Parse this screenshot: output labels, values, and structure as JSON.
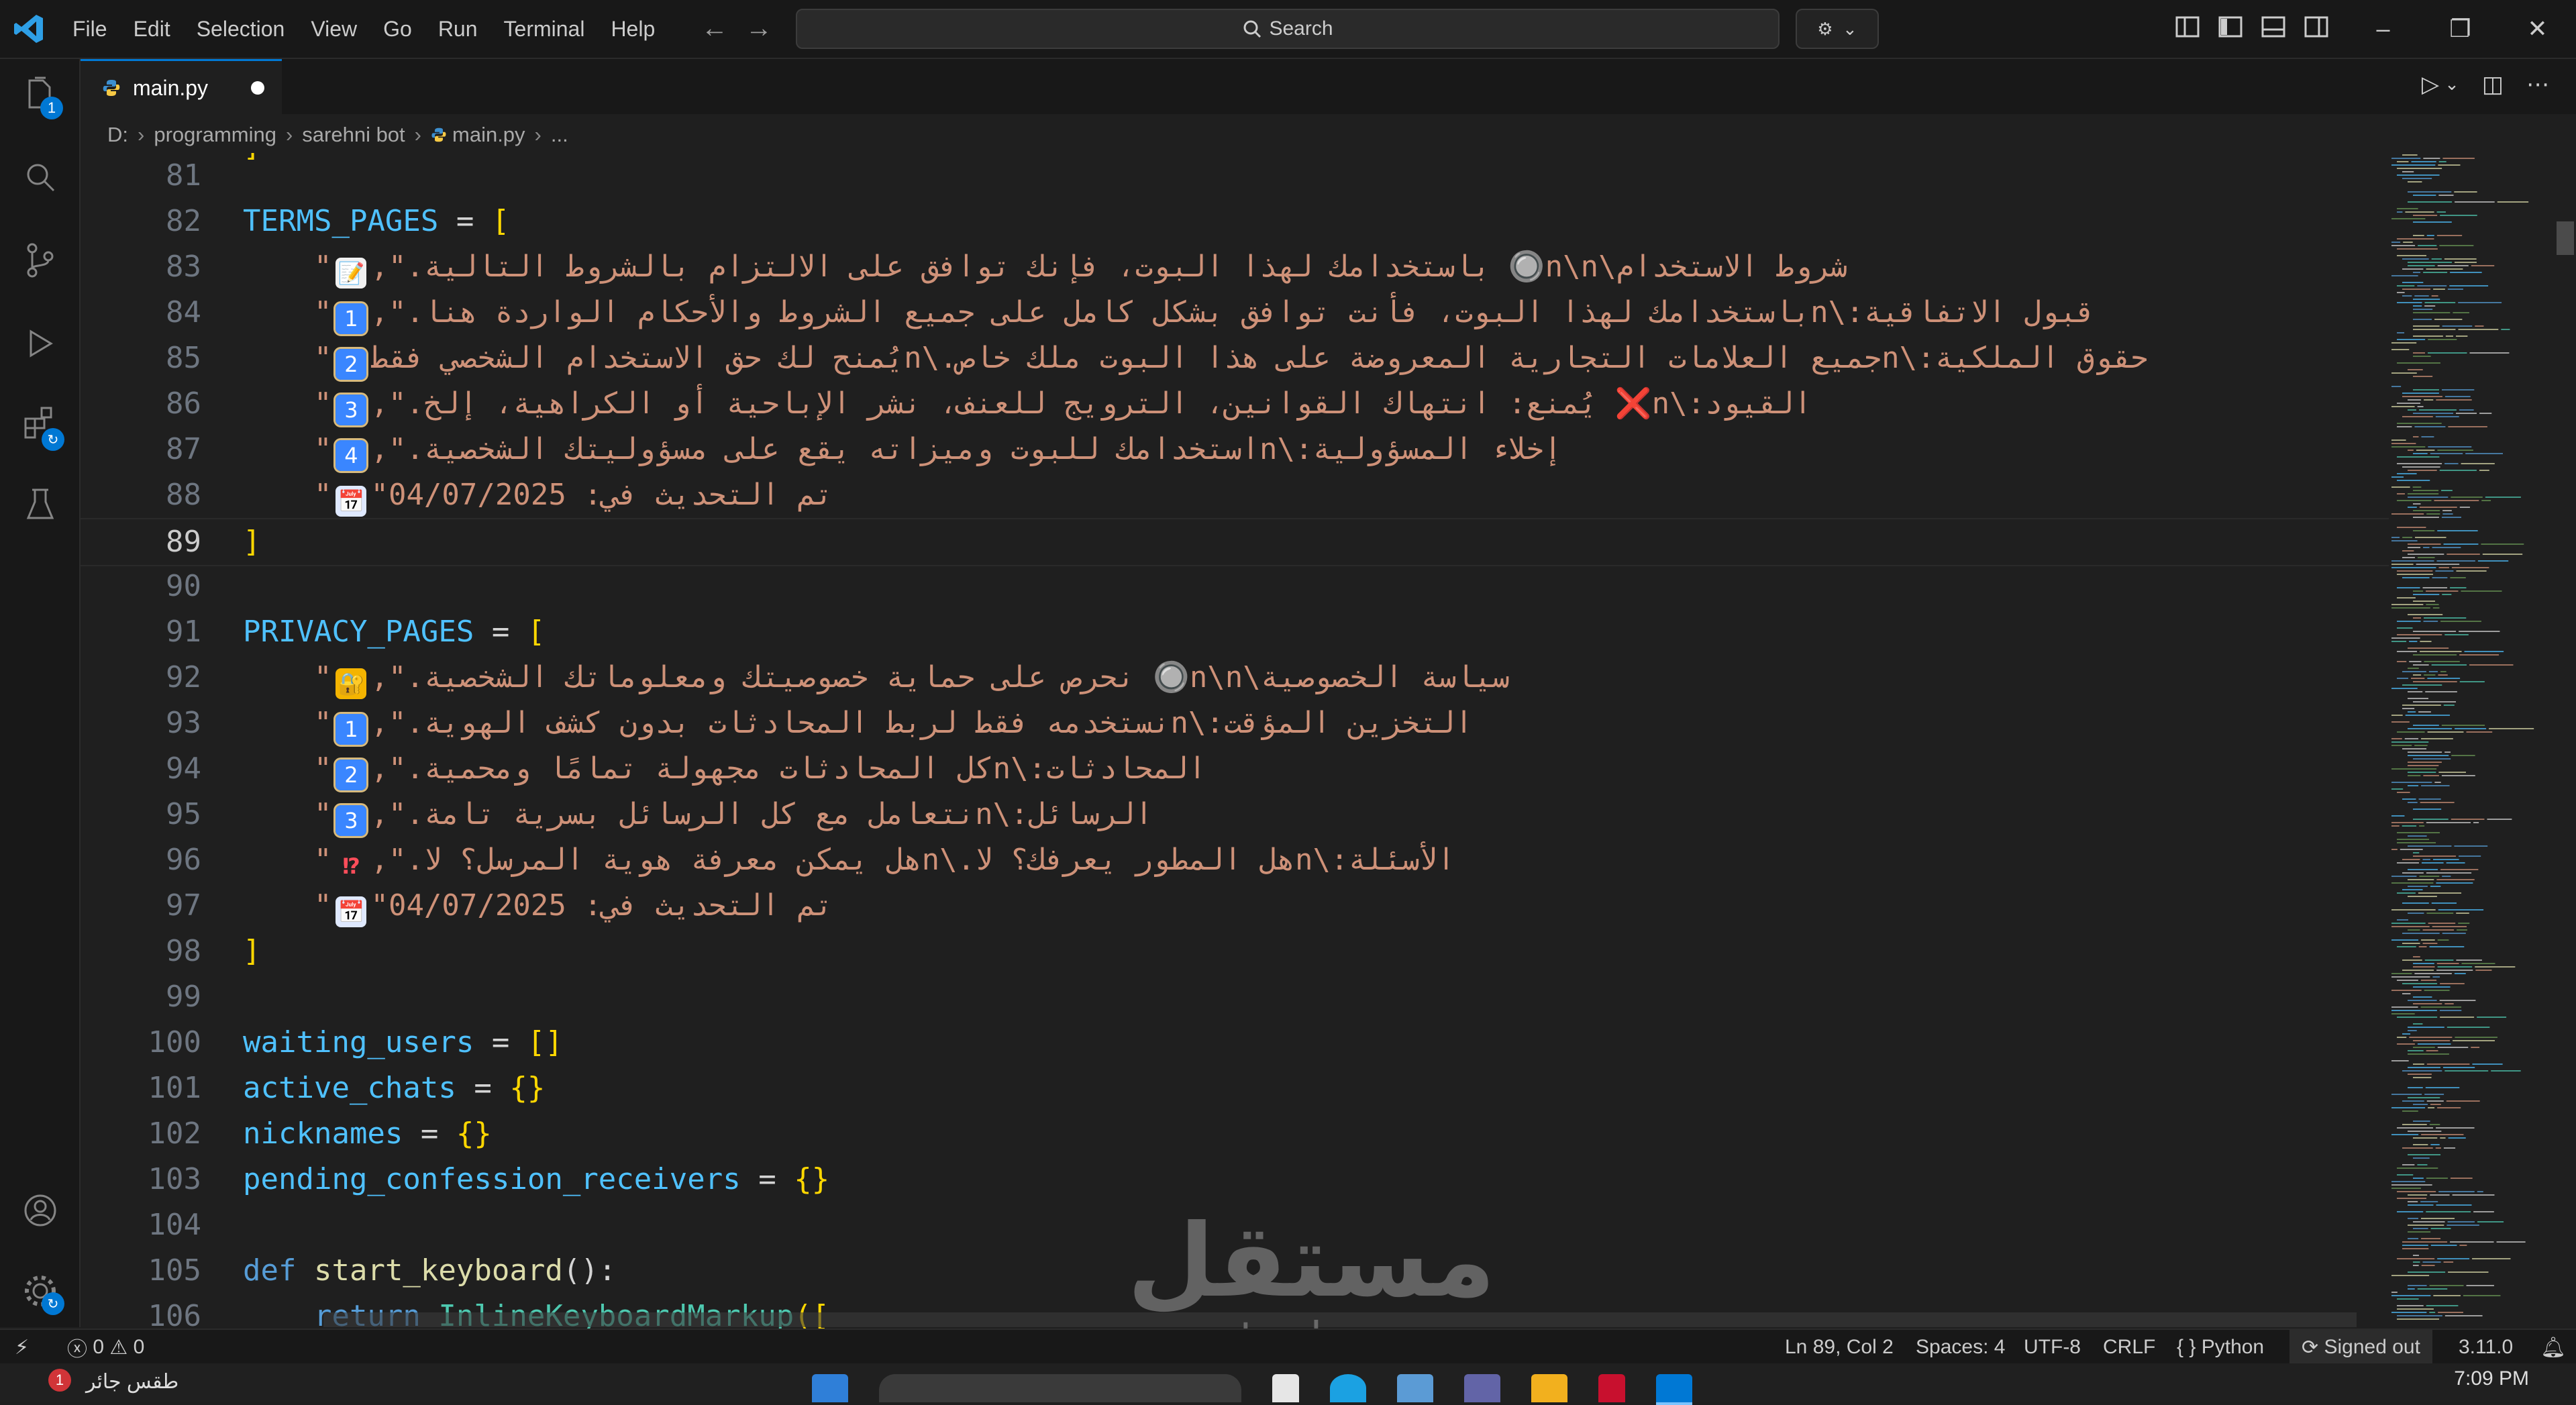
{
  "menu": [
    "File",
    "Edit",
    "Selection",
    "View",
    "Go",
    "Run",
    "Terminal",
    "Help"
  ],
  "search": {
    "placeholder": "Search"
  },
  "explorer_badge": "1",
  "tab": {
    "name": "main.py"
  },
  "breadcrumb": {
    "drive": "D:",
    "folder1": "programming",
    "folder2": "sarehni bot",
    "file": "main.py",
    "more": "..."
  },
  "editor": {
    "top_partial": "]",
    "lines": [
      {
        "n": "81"
      },
      {
        "n": "82",
        "var": "TERMS_PAGES",
        "op": " = ",
        "brk": "["
      },
      {
        "n": "83",
        "pre": "    \"",
        "emoji": "📝",
        "text": "شروط الاستخدام\\n\\n🔘 باستخدامك لهذا البوت، فإنك توافق على الالتزام بالشروط التالية.\","
      },
      {
        "n": "84",
        "pre": "    \"",
        "emoji": "1",
        "text": "قبول الاتفاقية:\\nباستخدامك لهذا البوت، فأنت توافق بشكل كامل على جميع الشروط والأحكام الواردة هنا.\","
      },
      {
        "n": "85",
        "pre": "    \"",
        "emoji": "2",
        "text": "حقوق الملكية:\\nجميع العلامات التجارية المعروضة على هذا البوت ملك خاص.\\nيُمنح لك حق الاستخدام الشخصي فقط"
      },
      {
        "n": "86",
        "pre": "    \"",
        "emoji": "3",
        "text": "القيود:\\n❌ يُمنع: انتهاك القوانين، الترويج للعنف، نشر الإباحية أو الكراهية، إلخ.\","
      },
      {
        "n": "87",
        "pre": "    \"",
        "emoji": "4",
        "text": "إخلاء المسؤولية:\\nاستخدامك للبوت وميزاته يقع على مسؤوليتك الشخصية.\","
      },
      {
        "n": "88",
        "pre": "    \"",
        "emoji": "📅",
        "text": "تم التحديث في: 04/07/2025\""
      },
      {
        "n": "89",
        "brk": "]",
        "current": true
      },
      {
        "n": "90"
      },
      {
        "n": "91",
        "var": "PRIVACY_PAGES",
        "op": " = ",
        "brk": "["
      },
      {
        "n": "92",
        "pre": "    \"",
        "emoji": "🔐",
        "text": "سياسة الخصوصية\\n\\n🔘 نحرص على حماية خصوصيتك ومعلوماتك الشخصية.\","
      },
      {
        "n": "93",
        "pre": "    \"",
        "emoji": "1",
        "text": "التخزين المؤقت:\\nنستخدمه فقط لربط المحادثات بدون كشف الهوية.\","
      },
      {
        "n": "94",
        "pre": "    \"",
        "emoji": "2",
        "text": "المحادثات:\\nكل المحادثات مجهولة تمامًا ومحمية.\","
      },
      {
        "n": "95",
        "pre": "    \"",
        "emoji": "3",
        "text": "الرسائل:\\nنتعامل مع كل الرسائل بسرية تامة.\","
      },
      {
        "n": "96",
        "pre": "    \"",
        "emoji": "⁉",
        "text": "الأسئلة:\\nهل المطور يعرفك؟ لا.\\nهل يمكن معرفة هوية المرسل؟ لا.\","
      },
      {
        "n": "97",
        "pre": "    \"",
        "emoji": "📅",
        "text": "تم التحديث في: 04/07/2025\""
      },
      {
        "n": "98",
        "brk": "]"
      },
      {
        "n": "99"
      },
      {
        "n": "100",
        "var": "waiting_users",
        "op": " = ",
        "brk": "[]"
      },
      {
        "n": "101",
        "var": "active_chats",
        "op": " = ",
        "brk": "{}"
      },
      {
        "n": "102",
        "var": "nicknames",
        "op": " = ",
        "brk": "{}"
      },
      {
        "n": "103",
        "var": "pending_confession_receivers",
        "op": " = ",
        "brk": "{}"
      },
      {
        "n": "104"
      },
      {
        "n": "105",
        "kw": "def",
        "fn": "start_keyboard",
        "rest": "():"
      },
      {
        "n": "106",
        "kw2": "    return",
        "cls": "InlineKeyboardMarkup",
        "brk": "(["
      }
    ]
  },
  "status": {
    "errors": "0",
    "warnings": "0",
    "position": "Ln 89, Col 2",
    "spaces": "Spaces: 4",
    "encoding": "UTF-8",
    "eol": "CRLF",
    "language": "Python",
    "account": "Signed out",
    "version": "3.11.0"
  },
  "watermark": {
    "arabic": "مستقل",
    "latin": "mostaql.com"
  },
  "taskbar": {
    "weather": "طقس جائر",
    "clock": "7:09 PM",
    "weather_badge": "1"
  },
  "colors": {
    "accent": "#0078d4",
    "background": "#1f1f1f",
    "string": "#ce9178",
    "variable": "#4fc1ff",
    "bracket": "#ffd700"
  }
}
